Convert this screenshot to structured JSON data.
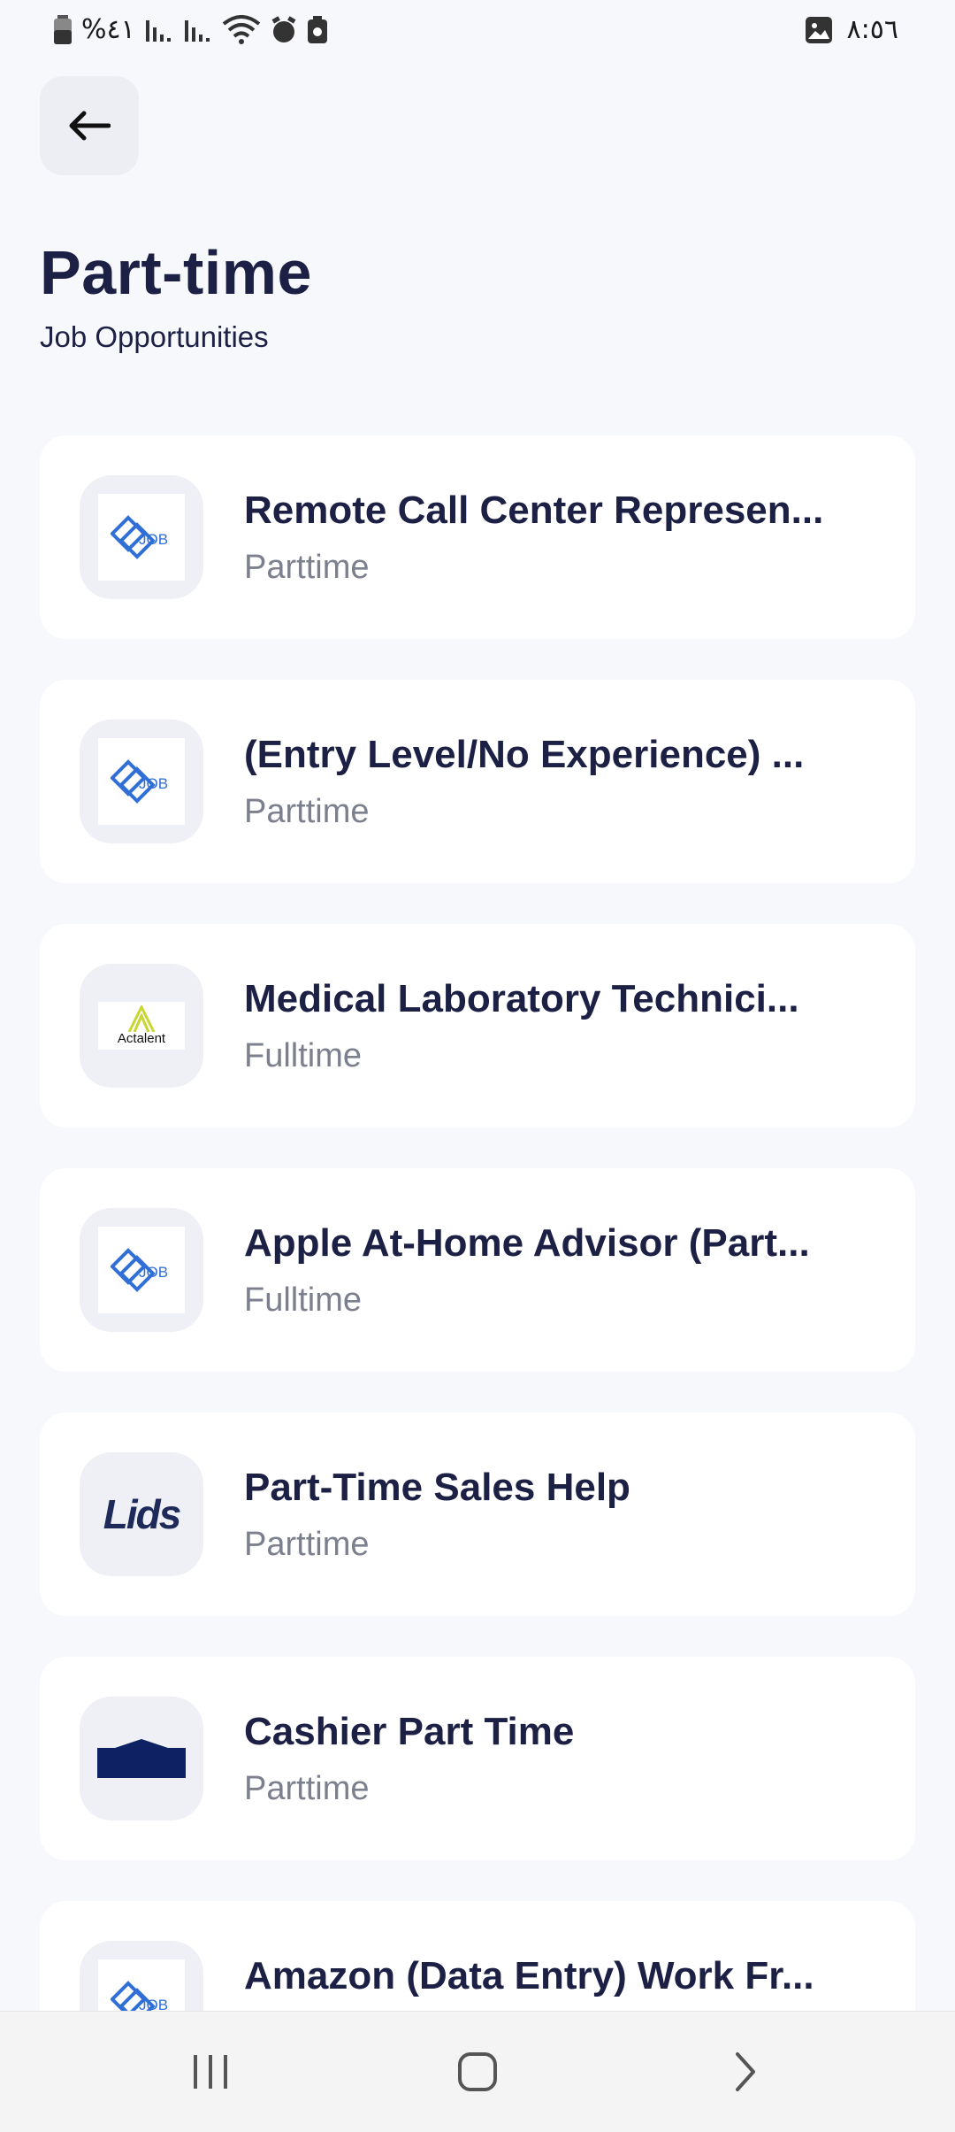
{
  "status_bar": {
    "battery": "%٤١",
    "time": "٨:٥٦"
  },
  "header": {
    "back_icon": "arrow-left-icon",
    "title": "Part-time",
    "subtitle": "Job Opportunities"
  },
  "jobs": [
    {
      "title": "Remote Call Center Represen...",
      "type": "Parttime",
      "logo": "job-logo"
    },
    {
      "title": "(Entry Level/No Experience) ...",
      "type": "Parttime",
      "logo": "job-logo"
    },
    {
      "title": "Medical Laboratory Technici...",
      "type": "Fulltime",
      "logo": "actalent-logo",
      "logo_text": "Actalent"
    },
    {
      "title": "Apple At-Home Advisor (Part...",
      "type": "Fulltime",
      "logo": "job-logo"
    },
    {
      "title": "Part-Time Sales Help",
      "type": "Parttime",
      "logo": "lids-logo",
      "logo_text": "Lids"
    },
    {
      "title": "Cashier Part Time",
      "type": "Parttime",
      "logo": "store-logo"
    },
    {
      "title": "Amazon (Data Entry) Work Fr...",
      "type": "",
      "logo": "job-logo"
    }
  ],
  "colors": {
    "background": "#f7f8fc",
    "title": "#1c2045",
    "secondary": "#7c7f8d",
    "job_logo_blue": "#2f6fd6"
  },
  "nav_bar": {
    "recents_icon": "recents-icon",
    "home_icon": "home-icon",
    "back_icon": "nav-back-icon"
  }
}
